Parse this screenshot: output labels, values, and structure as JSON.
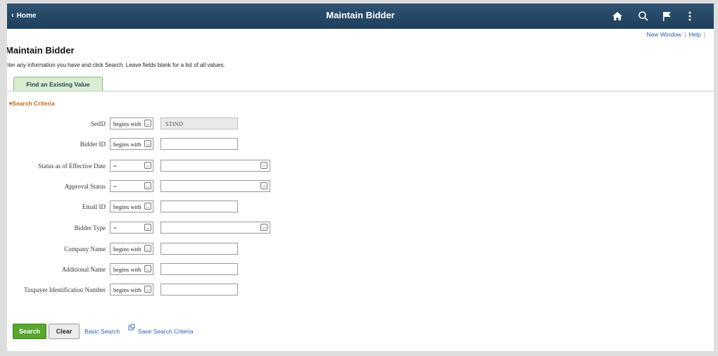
{
  "topbar": {
    "home_label": "Home",
    "title": "Maintain Bidder",
    "icons": [
      "home-icon",
      "search-icon",
      "flag-icon",
      "more-vertical-icon"
    ]
  },
  "links": {
    "new_window": "New Window",
    "help": "Help",
    "separator": "|"
  },
  "page": {
    "title": "Maintain Bidder",
    "instructions": "nter any information you have and click Search. Leave fields blank for a list of all values."
  },
  "tab": {
    "label": "Find an Existing Value"
  },
  "search_criteria": {
    "header": "Search Criteria",
    "fields": [
      {
        "label": "SetID",
        "operator": "begins with",
        "value": "STIND",
        "kind": "text",
        "disabled": true
      },
      {
        "label": "Bidder ID",
        "operator": "begins with",
        "value": "",
        "kind": "text"
      },
      {
        "label": "Status as of Effective Date",
        "operator": "=",
        "value": "",
        "kind": "select"
      },
      {
        "label": "Approval Status",
        "operator": "=",
        "value": "",
        "kind": "select"
      },
      {
        "label": "Email ID",
        "operator": "begins with",
        "value": "",
        "kind": "text"
      },
      {
        "label": "Bidder Type",
        "operator": "=",
        "value": "",
        "kind": "select"
      },
      {
        "label": "Company Name",
        "operator": "begins with",
        "value": "",
        "kind": "text"
      },
      {
        "label": "Additional Name",
        "operator": "begins with",
        "value": "",
        "kind": "text"
      },
      {
        "label": "Taxpayer Identification Number",
        "operator": "begins with",
        "value": "",
        "kind": "text"
      }
    ]
  },
  "actions": {
    "search": "Search",
    "clear": "Clear",
    "basic_search": "Basic Search",
    "save_search_criteria": "Save Search Criteria"
  },
  "colors": {
    "header_bg": "#1f3f5c",
    "link": "#2a5db0",
    "search_button": "#5aa62f",
    "criteria_header": "#c06a1c"
  }
}
